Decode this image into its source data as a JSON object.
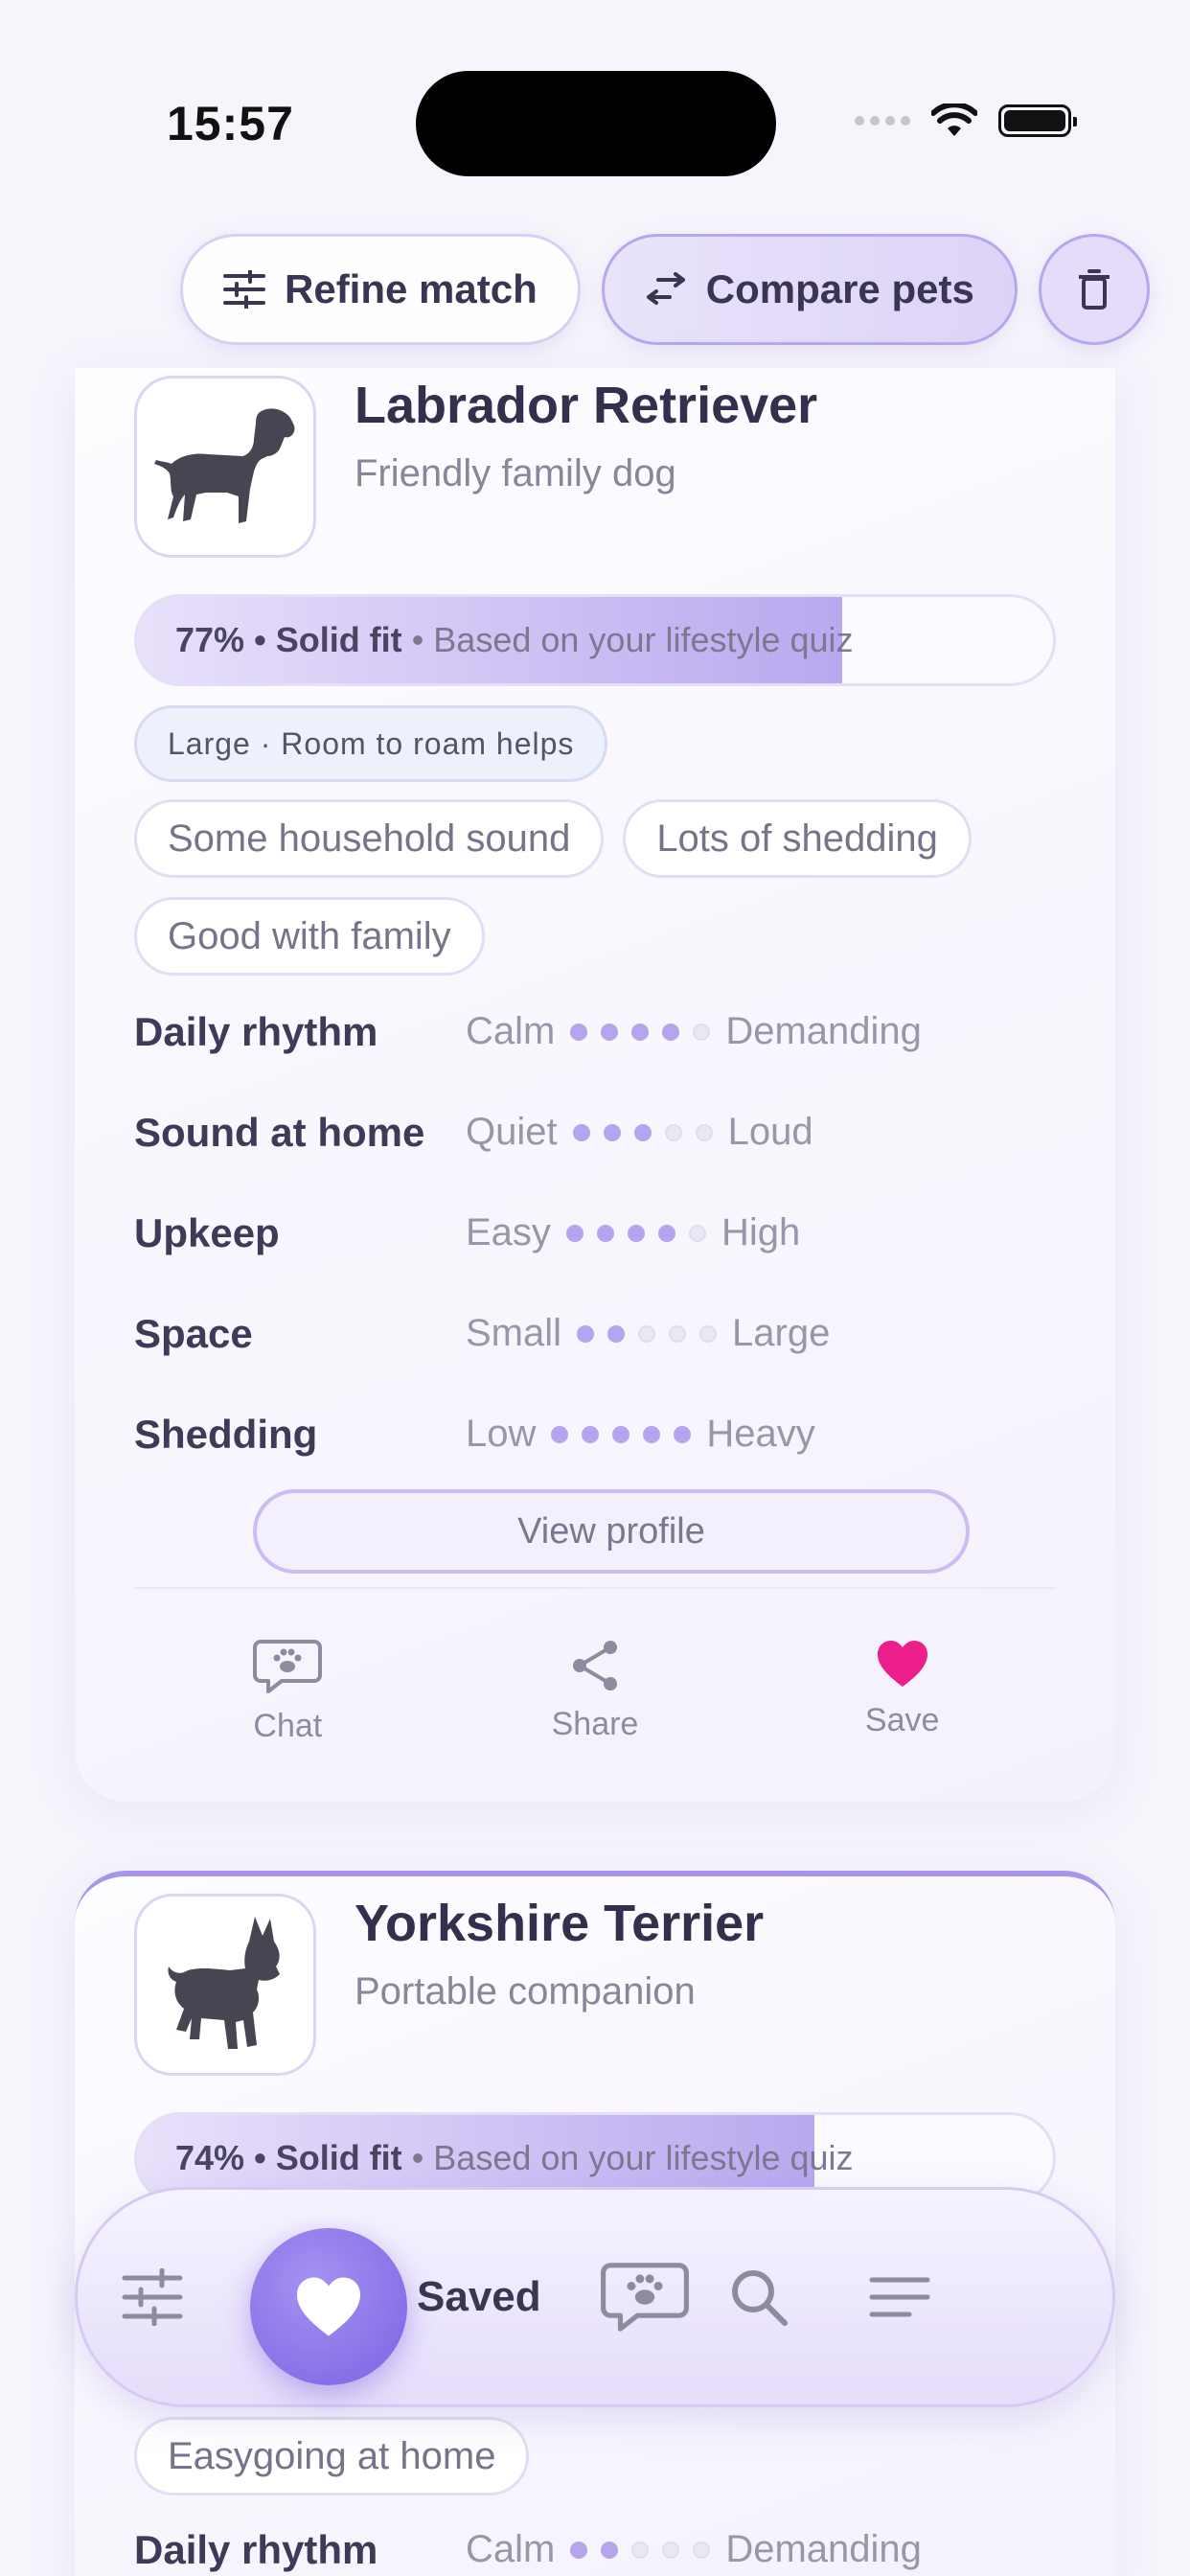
{
  "status_bar": {
    "time": "15:57"
  },
  "toolbar": {
    "refine_label": "Refine match",
    "compare_label": "Compare pets"
  },
  "cards": [
    {
      "name": "Labrador Retriever",
      "tagline": "Friendly family dog",
      "fit": {
        "percent": "77%",
        "label": "Solid fit",
        "basis": "Based on your lifestyle quiz",
        "fill_fraction": 0.77
      },
      "size_chip": "Large · Room to roam helps",
      "chips": [
        "Some household sound",
        "Lots of shedding",
        "Good with family"
      ],
      "traits": [
        {
          "name": "Daily rhythm",
          "low": "Calm",
          "high": "Demanding",
          "level": 4
        },
        {
          "name": "Sound at home",
          "low": "Quiet",
          "high": "Loud",
          "level": 3
        },
        {
          "name": "Upkeep",
          "low": "Easy",
          "high": "High",
          "level": 4
        },
        {
          "name": "Space",
          "low": "Small",
          "high": "Large",
          "level": 2
        },
        {
          "name": "Shedding",
          "low": "Low",
          "high": "Heavy",
          "level": 5
        }
      ],
      "view_profile": "View profile",
      "actions": {
        "chat": "Chat",
        "share": "Share",
        "save": "Save"
      }
    },
    {
      "name": "Yorkshire Terrier",
      "tagline": "Portable companion",
      "fit": {
        "percent": "74%",
        "label": "Solid fit",
        "basis": "Based on your lifestyle quiz",
        "fill_fraction": 0.74
      },
      "chips": [
        "Easygoing at home"
      ],
      "traits": [
        {
          "name": "Daily rhythm",
          "low": "Calm",
          "high": "Demanding",
          "level": 2
        }
      ]
    }
  ],
  "tabbar": {
    "saved_label": "Saved"
  },
  "colors": {
    "accent": "#7b63e3",
    "heart": "#ec1e8c"
  }
}
